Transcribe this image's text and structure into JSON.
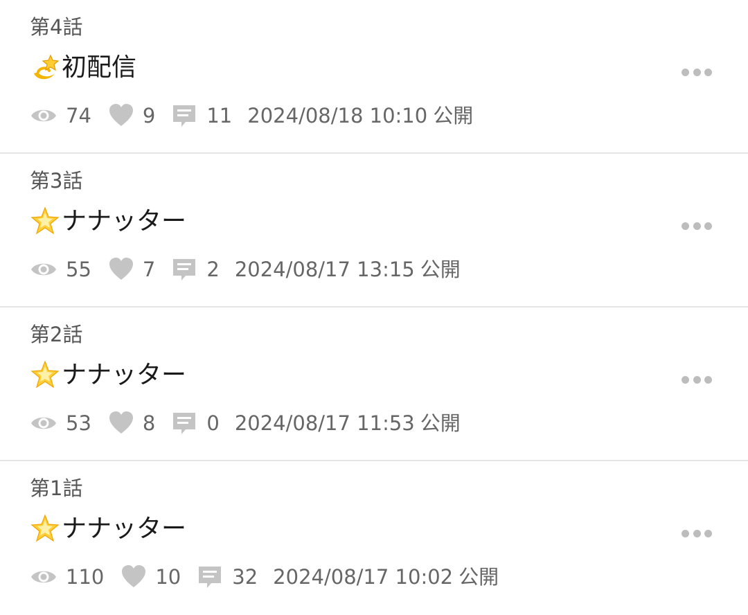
{
  "episodes": [
    {
      "number": "第4話",
      "emoji": "dizzy-icon",
      "title": "初配信",
      "views": "74",
      "likes": "9",
      "comments": "11",
      "published_at": "2024/08/18 10:10",
      "published_label": "公開"
    },
    {
      "number": "第3話",
      "emoji": "glowing-star-icon",
      "title": "ナナッター",
      "views": "55",
      "likes": "7",
      "comments": "2",
      "published_at": "2024/08/17 13:15",
      "published_label": "公開"
    },
    {
      "number": "第2話",
      "emoji": "glowing-star-icon",
      "title": "ナナッター",
      "views": "53",
      "likes": "8",
      "comments": "0",
      "published_at": "2024/08/17 11:53",
      "published_label": "公開"
    },
    {
      "number": "第1話",
      "emoji": "glowing-star-icon",
      "title": "ナナッター",
      "views": "110",
      "likes": "10",
      "comments": "32",
      "published_at": "2024/08/17 10:02",
      "published_label": "公開"
    }
  ],
  "icons": {
    "stat_color": "#c4c4c4",
    "more_dots_color": "#bdbdbd"
  }
}
